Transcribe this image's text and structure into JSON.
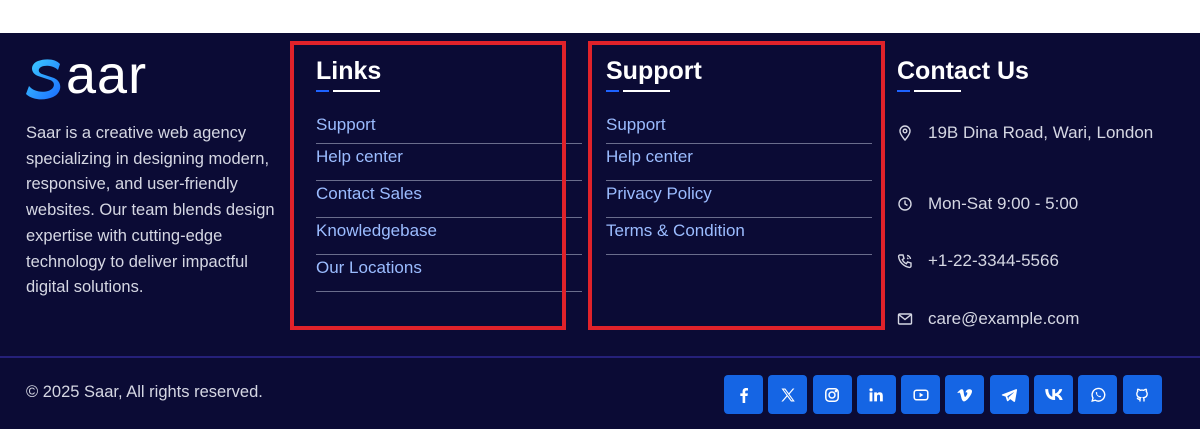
{
  "brand": {
    "logo_text": "aar",
    "about": "Saar is a creative web agency specializing in designing modern, responsive, and user-friendly websites. Our team blends design expertise with cutting-edge technology to deliver impactful digital solutions."
  },
  "links": {
    "title": "Links",
    "items": [
      {
        "label": "Support"
      },
      {
        "label": "Help center"
      },
      {
        "label": "Contact Sales"
      },
      {
        "label": "Knowledgebase"
      },
      {
        "label": "Our Locations"
      }
    ]
  },
  "support": {
    "title": "Support",
    "items": [
      {
        "label": "Support"
      },
      {
        "label": "Help center"
      },
      {
        "label": "Privacy Policy"
      },
      {
        "label": "Terms & Condition"
      }
    ]
  },
  "contact": {
    "title": "Contact Us",
    "items": [
      {
        "icon": "location-pin-icon",
        "text": "19B Dina Road, Wari, London"
      },
      {
        "icon": "clock-icon",
        "text": "Mon-Sat 9:00 - 5:00"
      },
      {
        "icon": "phone-icon",
        "text": "+1-22-3344-5566"
      },
      {
        "icon": "mail-icon",
        "text": "care@example.com"
      }
    ]
  },
  "footer": {
    "copyright": "© 2025 Saar, All rights reserved.",
    "socials": [
      "facebook-icon",
      "x-icon",
      "instagram-icon",
      "linkedin-icon",
      "youtube-icon",
      "vimeo-icon",
      "telegram-icon",
      "vk-icon",
      "whatsapp-icon",
      "github-icon"
    ]
  },
  "colors": {
    "background": "#0b0b35",
    "link": "#9bbcff",
    "accent": "#1565e4",
    "highlight": "#e0222a"
  }
}
